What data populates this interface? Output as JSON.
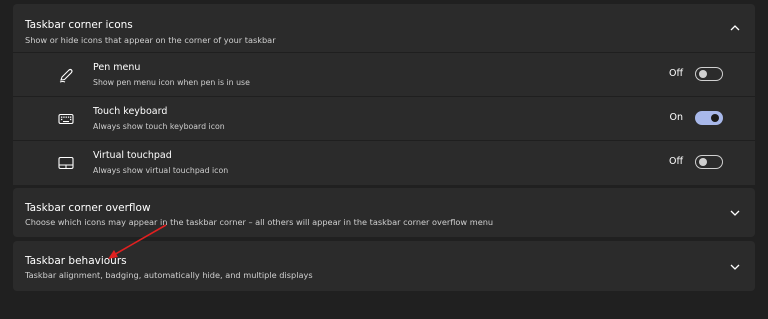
{
  "corner_icons": {
    "title": "Taskbar corner icons",
    "subtitle": "Show or hide icons that appear on the corner of your taskbar",
    "expanded": true,
    "items": [
      {
        "icon": "pen-icon",
        "title": "Pen menu",
        "subtitle": "Show pen menu icon when pen is in use",
        "state": "Off",
        "on": false
      },
      {
        "icon": "keyboard-icon",
        "title": "Touch keyboard",
        "subtitle": "Always show touch keyboard icon",
        "state": "On",
        "on": true
      },
      {
        "icon": "touchpad-icon",
        "title": "Virtual touchpad",
        "subtitle": "Always show virtual touchpad icon",
        "state": "Off",
        "on": false
      }
    ]
  },
  "corner_overflow": {
    "title": "Taskbar corner overflow",
    "subtitle": "Choose which icons may appear in the taskbar corner – all others will appear in the taskbar corner overflow menu",
    "expanded": false
  },
  "behaviours": {
    "title": "Taskbar behaviours",
    "subtitle": "Taskbar alignment, badging, automatically hide, and multiple displays",
    "expanded": false
  },
  "colors": {
    "background": "#202020",
    "card": "#2b2b2b",
    "toggle_on": "#a8b8ea",
    "annotation_arrow": "#e02020"
  }
}
